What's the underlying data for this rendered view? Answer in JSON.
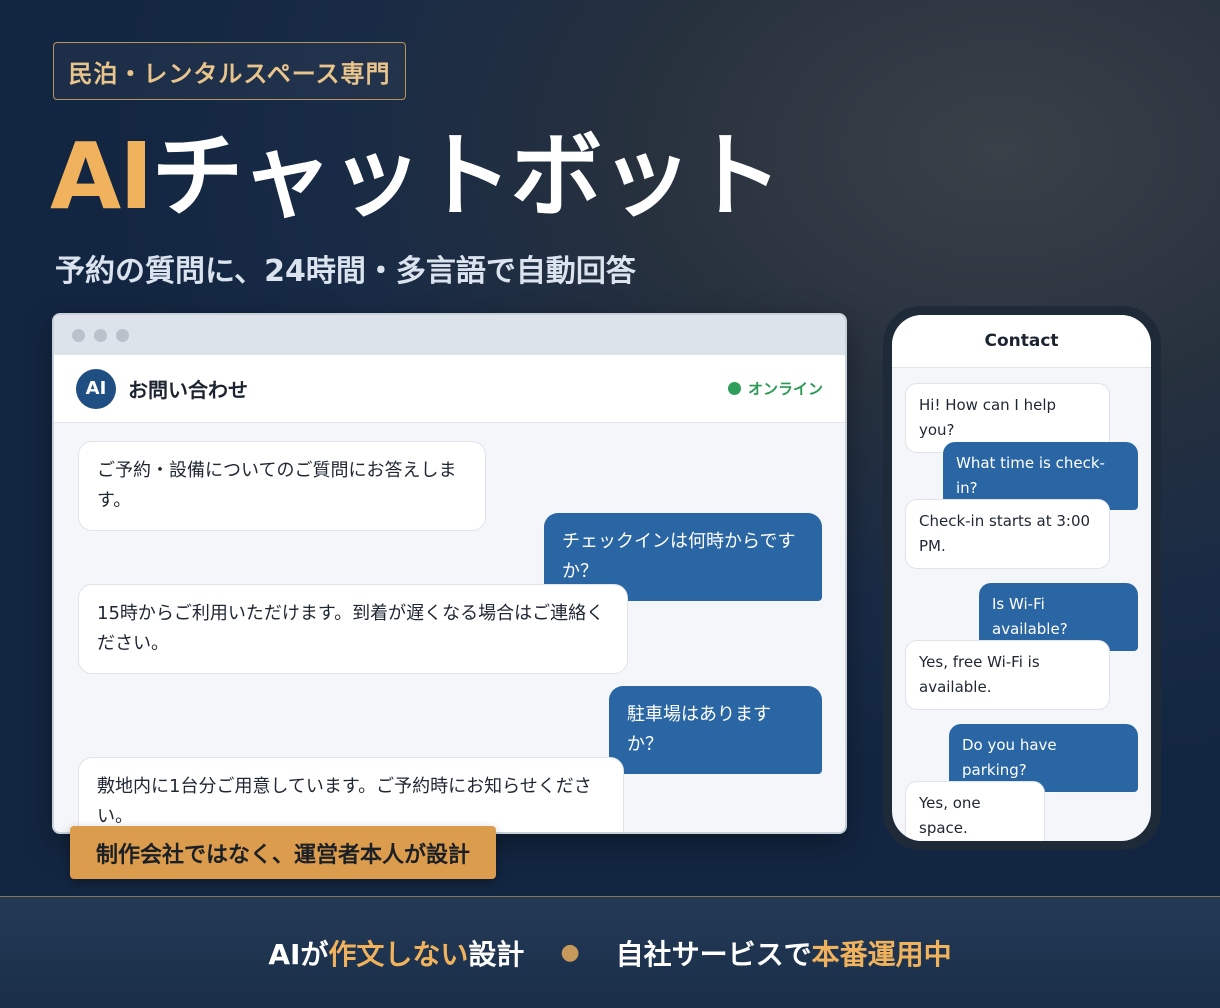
{
  "badge": "民泊・レンタルスペース専門",
  "hero": {
    "title_accent": "AI",
    "title_rest": "チャットボット",
    "subtitle": "予約の質問に、24時間・多言語で自動回答"
  },
  "desktop_chat": {
    "title": "お問い合わせ",
    "avatar": "AI",
    "status": "オンライン",
    "messages": [
      {
        "from": "bot",
        "text": "ご予約・設備についてのご質問にお答えします。"
      },
      {
        "from": "user",
        "text": "チェックインは何時からですか？"
      },
      {
        "from": "bot",
        "text": "15時からご利用いただけます。到着が遅くなる場合はご連絡ください。"
      },
      {
        "from": "user",
        "text": "駐車場はありますか？"
      },
      {
        "from": "bot",
        "text": "敷地内に1台分ご用意しています。ご予約時にお知らせください。"
      }
    ]
  },
  "ribbon": "制作会社ではなく、運営者本人が設計",
  "phone_chat": {
    "title": "Contact",
    "messages": [
      {
        "from": "bot",
        "text": "Hi! How can I help you?"
      },
      {
        "from": "user",
        "text": "What time is check-in?"
      },
      {
        "from": "bot",
        "text": "Check-in starts at 3:00 PM."
      },
      {
        "from": "user",
        "text": "Is Wi-Fi available?"
      },
      {
        "from": "bot",
        "text": "Yes, free Wi-Fi is available."
      },
      {
        "from": "user",
        "text": "Do you have parking?"
      },
      {
        "from": "bot",
        "text": "Yes, one space."
      }
    ]
  },
  "footer": {
    "left_a": "AIが",
    "left_b": "作文しない",
    "left_c": "設計",
    "separator": "●",
    "right_a": "自社サービスで",
    "right_b": "本番運用中"
  },
  "colors": {
    "accent": "#f0b25c",
    "user_bubble": "#2a66a3",
    "online": "#2e9e5a",
    "ribbon": "#dc9c4d"
  }
}
